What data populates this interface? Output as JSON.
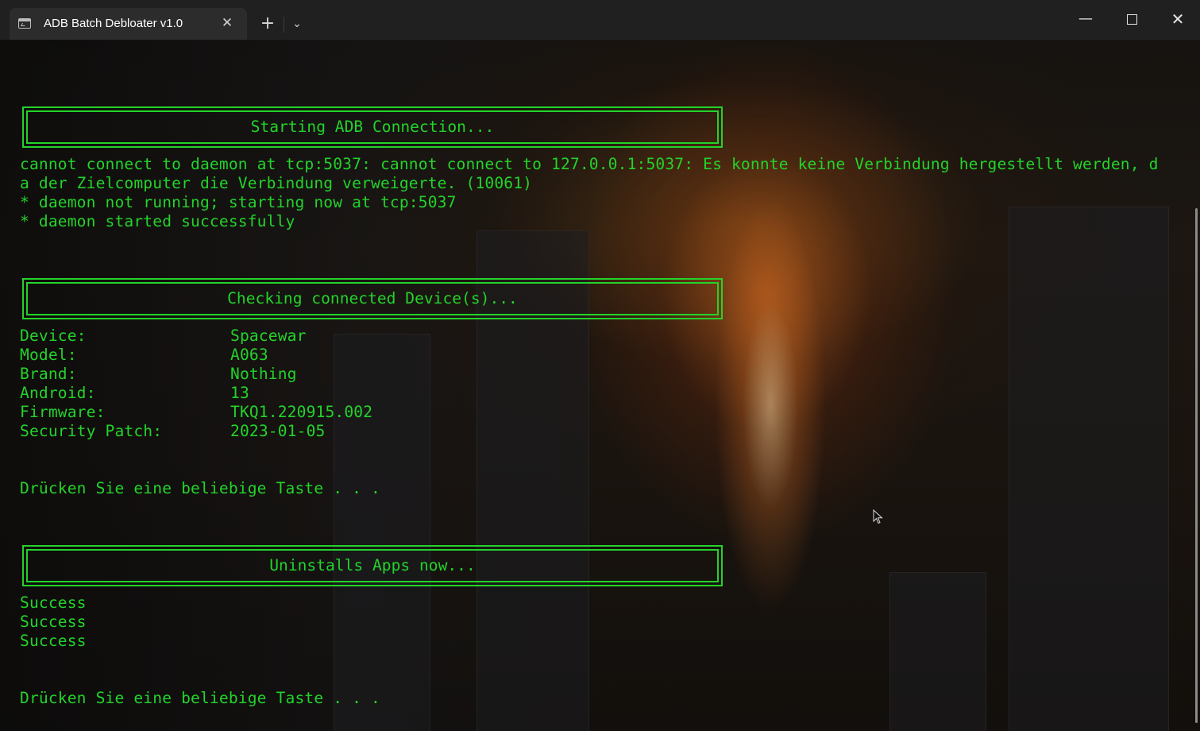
{
  "window": {
    "tab_title": "ADB Batch Debloater v1.0",
    "tab_close_glyph": "✕",
    "new_tab_glyph": "+",
    "dropdown_glyph": "⌄",
    "minimize_glyph": "—",
    "close_glyph": "✕"
  },
  "console": {
    "banner1": "Starting ADB Connection...",
    "connect_lines": [
      "cannot connect to daemon at tcp:5037: cannot connect to 127.0.0.1:5037: Es konnte keine Verbindung hergestellt werden, d",
      "a der Zielcomputer die Verbindung verweigerte. (10061)",
      "* daemon not running; starting now at tcp:5037",
      "* daemon started successfully"
    ],
    "banner2": "Checking connected Device(s)...",
    "device_info": [
      {
        "label": "Device:",
        "value": "Spacewar"
      },
      {
        "label": "Model:",
        "value": "A063"
      },
      {
        "label": "Brand:",
        "value": "Nothing"
      },
      {
        "label": "Android:",
        "value": "13"
      },
      {
        "label": "Firmware:",
        "value": "TKQ1.220915.002"
      },
      {
        "label": "Security Patch:",
        "value": "2023-01-05"
      }
    ],
    "press_key_1": "Drücken Sie eine beliebige Taste . . .",
    "banner3": "Uninstalls Apps now...",
    "results": [
      "Success",
      "Success",
      "Success"
    ],
    "press_key_2": "Drücken Sie eine beliebige Taste . . ."
  },
  "colors": {
    "terminal_text": "#23d32a",
    "titlebar": "#202020",
    "active_tab": "#2c2c2c"
  }
}
